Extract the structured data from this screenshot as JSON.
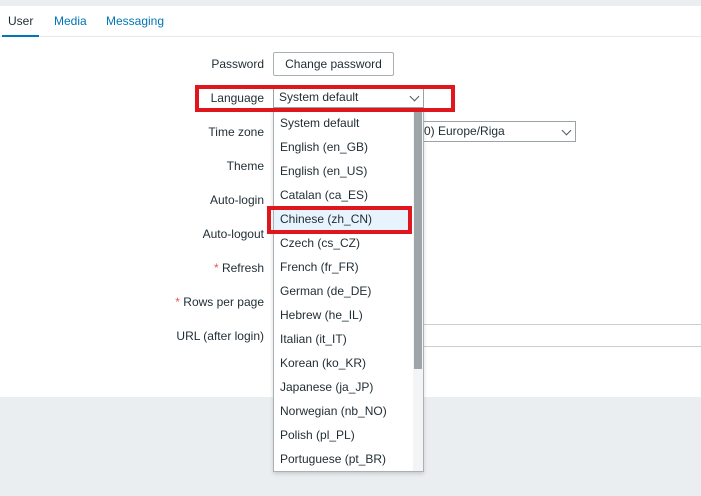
{
  "tabs": [
    {
      "label": "User",
      "active": true
    },
    {
      "label": "Media",
      "active": false
    },
    {
      "label": "Messaging",
      "active": false
    }
  ],
  "form": {
    "password_label": "Password",
    "change_password_button": "Change password",
    "language_label": "Language",
    "language_value": "System default",
    "timezone_label": "Time zone",
    "timezone_value_visible": "0) Europe/Riga",
    "theme_label": "Theme",
    "autologin_label": "Auto-login",
    "autologout_label": "Auto-logout",
    "refresh_label": "Refresh",
    "rows_per_page_label": "Rows per page",
    "url_after_login_label": "URL (after login)",
    "required_marker": "*"
  },
  "language_dropdown": {
    "options": [
      "System default",
      "English (en_GB)",
      "English (en_US)",
      "Catalan (ca_ES)",
      "Chinese (zh_CN)",
      "Czech (cs_CZ)",
      "French (fr_FR)",
      "German (de_DE)",
      "Hebrew (he_IL)",
      "Italian (it_IT)",
      "Korean (ko_KR)",
      "Japanese (ja_JP)",
      "Norwegian (nb_NO)",
      "Polish (pl_PL)",
      "Portuguese (pt_BR)"
    ],
    "highlighted_option": "Chinese (zh_CN)"
  },
  "colors": {
    "link": "#0275b8",
    "highlight_box": "#e0161d",
    "option_highlight": "#e7f3fd",
    "required": "#e45959"
  }
}
